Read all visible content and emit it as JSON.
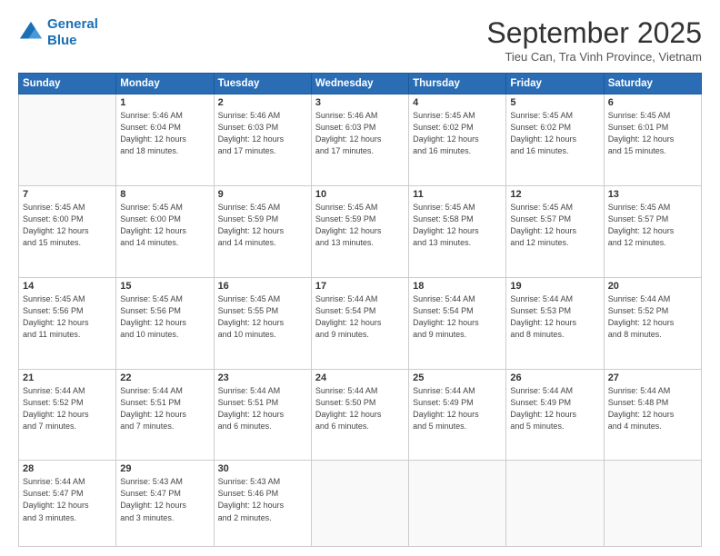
{
  "header": {
    "logo_line1": "General",
    "logo_line2": "Blue",
    "month_title": "September 2025",
    "subtitle": "Tieu Can, Tra Vinh Province, Vietnam"
  },
  "weekdays": [
    "Sunday",
    "Monday",
    "Tuesday",
    "Wednesday",
    "Thursday",
    "Friday",
    "Saturday"
  ],
  "weeks": [
    [
      {
        "day": "",
        "info": ""
      },
      {
        "day": "1",
        "info": "Sunrise: 5:46 AM\nSunset: 6:04 PM\nDaylight: 12 hours\nand 18 minutes."
      },
      {
        "day": "2",
        "info": "Sunrise: 5:46 AM\nSunset: 6:03 PM\nDaylight: 12 hours\nand 17 minutes."
      },
      {
        "day": "3",
        "info": "Sunrise: 5:46 AM\nSunset: 6:03 PM\nDaylight: 12 hours\nand 17 minutes."
      },
      {
        "day": "4",
        "info": "Sunrise: 5:45 AM\nSunset: 6:02 PM\nDaylight: 12 hours\nand 16 minutes."
      },
      {
        "day": "5",
        "info": "Sunrise: 5:45 AM\nSunset: 6:02 PM\nDaylight: 12 hours\nand 16 minutes."
      },
      {
        "day": "6",
        "info": "Sunrise: 5:45 AM\nSunset: 6:01 PM\nDaylight: 12 hours\nand 15 minutes."
      }
    ],
    [
      {
        "day": "7",
        "info": "Sunrise: 5:45 AM\nSunset: 6:00 PM\nDaylight: 12 hours\nand 15 minutes."
      },
      {
        "day": "8",
        "info": "Sunrise: 5:45 AM\nSunset: 6:00 PM\nDaylight: 12 hours\nand 14 minutes."
      },
      {
        "day": "9",
        "info": "Sunrise: 5:45 AM\nSunset: 5:59 PM\nDaylight: 12 hours\nand 14 minutes."
      },
      {
        "day": "10",
        "info": "Sunrise: 5:45 AM\nSunset: 5:59 PM\nDaylight: 12 hours\nand 13 minutes."
      },
      {
        "day": "11",
        "info": "Sunrise: 5:45 AM\nSunset: 5:58 PM\nDaylight: 12 hours\nand 13 minutes."
      },
      {
        "day": "12",
        "info": "Sunrise: 5:45 AM\nSunset: 5:57 PM\nDaylight: 12 hours\nand 12 minutes."
      },
      {
        "day": "13",
        "info": "Sunrise: 5:45 AM\nSunset: 5:57 PM\nDaylight: 12 hours\nand 12 minutes."
      }
    ],
    [
      {
        "day": "14",
        "info": "Sunrise: 5:45 AM\nSunset: 5:56 PM\nDaylight: 12 hours\nand 11 minutes."
      },
      {
        "day": "15",
        "info": "Sunrise: 5:45 AM\nSunset: 5:56 PM\nDaylight: 12 hours\nand 10 minutes."
      },
      {
        "day": "16",
        "info": "Sunrise: 5:45 AM\nSunset: 5:55 PM\nDaylight: 12 hours\nand 10 minutes."
      },
      {
        "day": "17",
        "info": "Sunrise: 5:44 AM\nSunset: 5:54 PM\nDaylight: 12 hours\nand 9 minutes."
      },
      {
        "day": "18",
        "info": "Sunrise: 5:44 AM\nSunset: 5:54 PM\nDaylight: 12 hours\nand 9 minutes."
      },
      {
        "day": "19",
        "info": "Sunrise: 5:44 AM\nSunset: 5:53 PM\nDaylight: 12 hours\nand 8 minutes."
      },
      {
        "day": "20",
        "info": "Sunrise: 5:44 AM\nSunset: 5:52 PM\nDaylight: 12 hours\nand 8 minutes."
      }
    ],
    [
      {
        "day": "21",
        "info": "Sunrise: 5:44 AM\nSunset: 5:52 PM\nDaylight: 12 hours\nand 7 minutes."
      },
      {
        "day": "22",
        "info": "Sunrise: 5:44 AM\nSunset: 5:51 PM\nDaylight: 12 hours\nand 7 minutes."
      },
      {
        "day": "23",
        "info": "Sunrise: 5:44 AM\nSunset: 5:51 PM\nDaylight: 12 hours\nand 6 minutes."
      },
      {
        "day": "24",
        "info": "Sunrise: 5:44 AM\nSunset: 5:50 PM\nDaylight: 12 hours\nand 6 minutes."
      },
      {
        "day": "25",
        "info": "Sunrise: 5:44 AM\nSunset: 5:49 PM\nDaylight: 12 hours\nand 5 minutes."
      },
      {
        "day": "26",
        "info": "Sunrise: 5:44 AM\nSunset: 5:49 PM\nDaylight: 12 hours\nand 5 minutes."
      },
      {
        "day": "27",
        "info": "Sunrise: 5:44 AM\nSunset: 5:48 PM\nDaylight: 12 hours\nand 4 minutes."
      }
    ],
    [
      {
        "day": "28",
        "info": "Sunrise: 5:44 AM\nSunset: 5:47 PM\nDaylight: 12 hours\nand 3 minutes."
      },
      {
        "day": "29",
        "info": "Sunrise: 5:43 AM\nSunset: 5:47 PM\nDaylight: 12 hours\nand 3 minutes."
      },
      {
        "day": "30",
        "info": "Sunrise: 5:43 AM\nSunset: 5:46 PM\nDaylight: 12 hours\nand 2 minutes."
      },
      {
        "day": "",
        "info": ""
      },
      {
        "day": "",
        "info": ""
      },
      {
        "day": "",
        "info": ""
      },
      {
        "day": "",
        "info": ""
      }
    ]
  ]
}
